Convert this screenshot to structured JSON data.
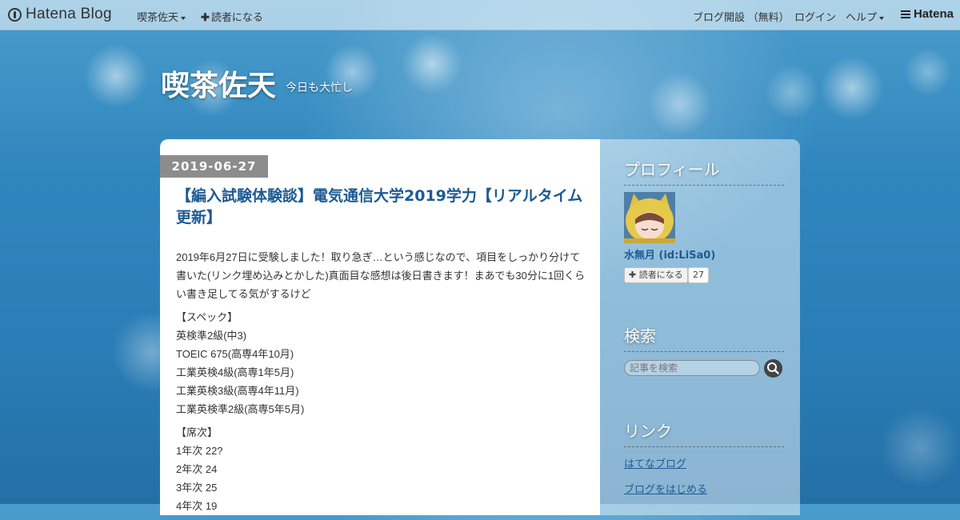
{
  "topbar": {
    "brand": "Hatena Blog",
    "blog_menu": "喫茶佐天",
    "follow": "読者になる",
    "open_blog": "ブログ開設 （無料）",
    "login": "ログイン",
    "help": "ヘルプ",
    "hatena": "Hatena"
  },
  "blog": {
    "title": "喫茶佐天",
    "description": "今日も大忙し"
  },
  "entry": {
    "date": "2019-06-27",
    "title": "【編入試験体験談】電気通信大学2019学力【リアルタイム更新】",
    "intro": "2019年6月27日に受験しました！取り急ぎ…という感じなので、項目をしっかり分けて書いた(リンク埋め込みとかした)真面目な感想は後日書きます！まあでも30分に1回くらい書き足してる気がするけど",
    "spec_heading": "【スペック】",
    "specs": [
      "英検準2級(中3)",
      "TOEIC 675(高専4年10月)",
      "工業英検4級(高専1年5月)",
      "工業英検3級(高専4年11月)",
      "工業英検準2級(高専5年5月)"
    ],
    "rank_heading": "【席次】",
    "ranks": [
      "1年次 22?",
      "2年次 24",
      "3年次 25",
      "4年次 19"
    ]
  },
  "sidebar": {
    "profile_title": "プロフィール",
    "profile_name": "水無月 (id:LiSa0)",
    "follow_label": "読者になる",
    "follower_count": "27",
    "search_title": "検索",
    "search_placeholder": "記事を検索",
    "links_title": "リンク",
    "links": [
      "はてなブログ",
      "ブログをはじめる"
    ]
  }
}
